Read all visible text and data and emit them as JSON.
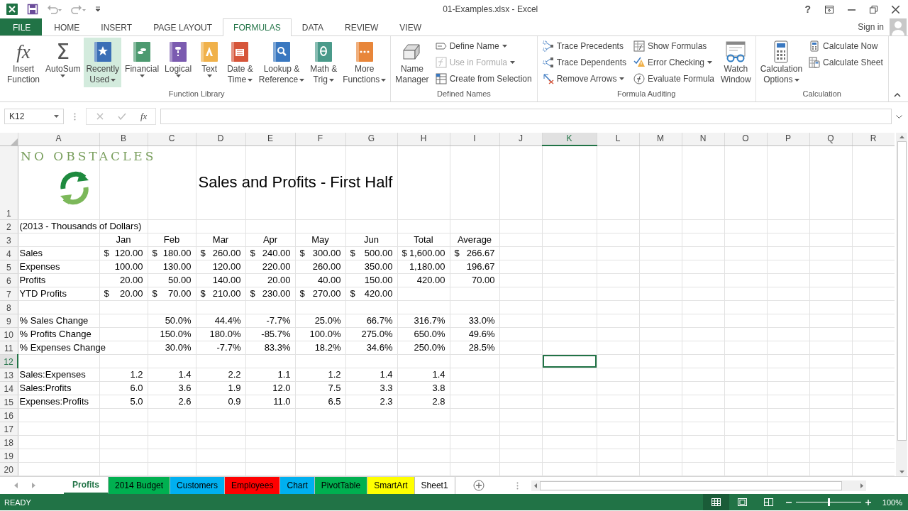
{
  "window": {
    "title": "01-Examples.xlsx - Excel",
    "help": "?",
    "sign_in": "Sign in"
  },
  "ribbon_tabs": [
    {
      "label": "FILE",
      "kind": "file",
      "selected": false
    },
    {
      "label": "HOME",
      "kind": "tab",
      "selected": false
    },
    {
      "label": "INSERT",
      "kind": "tab",
      "selected": false
    },
    {
      "label": "PAGE LAYOUT",
      "kind": "tab",
      "selected": false
    },
    {
      "label": "FORMULAS",
      "kind": "tab",
      "selected": true
    },
    {
      "label": "DATA",
      "kind": "tab",
      "selected": false
    },
    {
      "label": "REVIEW",
      "kind": "tab",
      "selected": false
    },
    {
      "label": "VIEW",
      "kind": "tab",
      "selected": false
    }
  ],
  "ribbon_groups": [
    {
      "label": "Function Library",
      "items": [
        {
          "kind": "large",
          "label": "Insert\nFunction",
          "glyph": "fx",
          "dropdown": false,
          "highlighted": false
        },
        {
          "kind": "large",
          "label": "AutoSum",
          "glyph": "Σ",
          "dropdown": true,
          "highlighted": false
        },
        {
          "kind": "large",
          "label": "Recently\nUsed",
          "dropdown": true,
          "highlighted": true
        },
        {
          "kind": "large",
          "label": "Financial",
          "dropdown": true,
          "highlighted": false
        },
        {
          "kind": "large",
          "label": "Logical",
          "dropdown": true,
          "highlighted": false
        },
        {
          "kind": "large",
          "label": "Text",
          "dropdown": true,
          "highlighted": false
        },
        {
          "kind": "large",
          "label": "Date &\nTime",
          "dropdown": true,
          "highlighted": false
        },
        {
          "kind": "large",
          "label": "Lookup &\nReference",
          "dropdown": true,
          "highlighted": false
        },
        {
          "kind": "large",
          "label": "Math &\nTrig",
          "dropdown": true,
          "highlighted": false
        },
        {
          "kind": "large",
          "label": "More\nFunctions",
          "dropdown": true,
          "highlighted": false
        }
      ]
    },
    {
      "label": "Defined Names",
      "items": [
        {
          "kind": "large",
          "label": "Name\nManager",
          "dropdown": false,
          "highlighted": false
        },
        {
          "kind": "column",
          "items": [
            {
              "label": "Define Name",
              "dropdown": true,
              "disabled": false
            },
            {
              "label": "Use in Formula",
              "dropdown": true,
              "disabled": true
            },
            {
              "label": "Create from Selection",
              "dropdown": false,
              "disabled": false
            }
          ]
        }
      ]
    },
    {
      "label": "Formula Auditing",
      "items": [
        {
          "kind": "column",
          "items": [
            {
              "label": "Trace Precedents",
              "dropdown": false,
              "disabled": false
            },
            {
              "label": "Trace Dependents",
              "dropdown": false,
              "disabled": false
            },
            {
              "label": "Remove Arrows",
              "dropdown": true,
              "disabled": false
            }
          ]
        },
        {
          "kind": "column",
          "items": [
            {
              "label": "Show Formulas",
              "dropdown": false,
              "disabled": false
            },
            {
              "label": "Error Checking",
              "dropdown": true,
              "disabled": false
            },
            {
              "label": "Evaluate Formula",
              "dropdown": false,
              "disabled": false
            }
          ]
        },
        {
          "kind": "large",
          "label": "Watch\nWindow",
          "dropdown": false,
          "highlighted": false
        }
      ]
    },
    {
      "label": "Calculation",
      "items": [
        {
          "kind": "large",
          "label": "Calculation\nOptions",
          "dropdown": true,
          "highlighted": false
        },
        {
          "kind": "column",
          "items": [
            {
              "label": "Calculate Now",
              "dropdown": false,
              "disabled": false
            },
            {
              "label": "Calculate Sheet",
              "dropdown": false,
              "disabled": false
            }
          ]
        }
      ]
    }
  ],
  "formula_bar": {
    "name_box": "K12",
    "fx": "fx"
  },
  "sheet": {
    "logo": {
      "text": "NO OBSTACLES"
    },
    "columns": [
      {
        "label": "A",
        "selected": false
      },
      {
        "label": "B",
        "selected": false
      },
      {
        "label": "C",
        "selected": false
      },
      {
        "label": "D",
        "selected": false
      },
      {
        "label": "E",
        "selected": false
      },
      {
        "label": "F",
        "selected": false
      },
      {
        "label": "G",
        "selected": false
      },
      {
        "label": "H",
        "selected": false
      },
      {
        "label": "I",
        "selected": false
      },
      {
        "label": "J",
        "selected": false
      },
      {
        "label": "K",
        "selected": true
      },
      {
        "label": "L",
        "selected": false
      },
      {
        "label": "M",
        "selected": false
      },
      {
        "label": "N",
        "selected": false
      },
      {
        "label": "O",
        "selected": false
      },
      {
        "label": "P",
        "selected": false
      },
      {
        "label": "Q",
        "selected": false
      },
      {
        "label": "R",
        "selected": false
      }
    ],
    "rows": [
      {
        "number": "1",
        "selected": false,
        "cells": [
          null,
          null,
          null,
          {
            "text": "Sales and Profits - First Half",
            "kind": "title"
          }
        ]
      },
      {
        "number": "2",
        "selected": false,
        "cells": [
          {
            "text": "(2013 - Thousands of Dollars)",
            "kind": "label"
          }
        ]
      },
      {
        "number": "3",
        "selected": false,
        "cells": [
          null,
          {
            "text": "Jan",
            "kind": "header"
          },
          {
            "text": "Feb",
            "kind": "header"
          },
          {
            "text": "Mar",
            "kind": "header"
          },
          {
            "text": "Apr",
            "kind": "header"
          },
          {
            "text": "May",
            "kind": "header"
          },
          {
            "text": "Jun",
            "kind": "header"
          },
          {
            "text": "Total",
            "kind": "header"
          },
          {
            "text": "Average",
            "kind": "header"
          }
        ]
      },
      {
        "number": "4",
        "selected": false,
        "cells": [
          {
            "text": "Sales",
            "kind": "label"
          },
          {
            "symbol": "$",
            "text": "120.00",
            "kind": "accounting"
          },
          {
            "symbol": "$",
            "text": "180.00",
            "kind": "accounting"
          },
          {
            "symbol": "$",
            "text": "260.00",
            "kind": "accounting"
          },
          {
            "symbol": "$",
            "text": "240.00",
            "kind": "accounting"
          },
          {
            "symbol": "$",
            "text": "300.00",
            "kind": "accounting"
          },
          {
            "symbol": "$",
            "text": "500.00",
            "kind": "accounting"
          },
          {
            "symbol": "$",
            "text": "1,600.00",
            "kind": "accounting"
          },
          {
            "symbol": "$",
            "text": "266.67",
            "kind": "accounting"
          }
        ]
      },
      {
        "number": "5",
        "selected": false,
        "cells": [
          {
            "text": "Expenses",
            "kind": "label"
          },
          {
            "text": "100.00",
            "kind": "number"
          },
          {
            "text": "130.00",
            "kind": "number"
          },
          {
            "text": "120.00",
            "kind": "number"
          },
          {
            "text": "220.00",
            "kind": "number"
          },
          {
            "text": "260.00",
            "kind": "number"
          },
          {
            "text": "350.00",
            "kind": "number"
          },
          {
            "text": "1,180.00",
            "kind": "number"
          },
          {
            "text": "196.67",
            "kind": "number"
          }
        ]
      },
      {
        "number": "6",
        "selected": false,
        "cells": [
          {
            "text": "Profits",
            "kind": "label"
          },
          {
            "text": "20.00",
            "kind": "number"
          },
          {
            "text": "50.00",
            "kind": "number"
          },
          {
            "text": "140.00",
            "kind": "number"
          },
          {
            "text": "20.00",
            "kind": "number"
          },
          {
            "text": "40.00",
            "kind": "number"
          },
          {
            "text": "150.00",
            "kind": "number"
          },
          {
            "text": "420.00",
            "kind": "number"
          },
          {
            "text": "70.00",
            "kind": "number"
          }
        ]
      },
      {
        "number": "7",
        "selected": false,
        "cells": [
          {
            "text": "YTD Profits",
            "kind": "label"
          },
          {
            "symbol": "$",
            "text": "20.00",
            "kind": "accounting"
          },
          {
            "symbol": "$",
            "text": "70.00",
            "kind": "accounting"
          },
          {
            "symbol": "$",
            "text": "210.00",
            "kind": "accounting"
          },
          {
            "symbol": "$",
            "text": "230.00",
            "kind": "accounting"
          },
          {
            "symbol": "$",
            "text": "270.00",
            "kind": "accounting"
          },
          {
            "symbol": "$",
            "text": "420.00",
            "kind": "accounting"
          }
        ]
      },
      {
        "number": "8",
        "selected": false,
        "cells": []
      },
      {
        "number": "9",
        "selected": false,
        "cells": [
          {
            "text": "% Sales Change",
            "kind": "label"
          },
          null,
          {
            "text": "50.0%",
            "kind": "number"
          },
          {
            "text": "44.4%",
            "kind": "number"
          },
          {
            "text": "-7.7%",
            "kind": "number"
          },
          {
            "text": "25.0%",
            "kind": "number"
          },
          {
            "text": "66.7%",
            "kind": "number"
          },
          {
            "text": "316.7%",
            "kind": "number"
          },
          {
            "text": "33.0%",
            "kind": "number"
          }
        ]
      },
      {
        "number": "10",
        "selected": false,
        "cells": [
          {
            "text": "% Profits Change",
            "kind": "label"
          },
          null,
          {
            "text": "150.0%",
            "kind": "number"
          },
          {
            "text": "180.0%",
            "kind": "number"
          },
          {
            "text": "-85.7%",
            "kind": "number"
          },
          {
            "text": "100.0%",
            "kind": "number"
          },
          {
            "text": "275.0%",
            "kind": "number"
          },
          {
            "text": "650.0%",
            "kind": "number"
          },
          {
            "text": "49.6%",
            "kind": "number"
          }
        ]
      },
      {
        "number": "11",
        "selected": false,
        "cells": [
          {
            "text": "% Expenses Change",
            "kind": "label"
          },
          null,
          {
            "text": "30.0%",
            "kind": "number"
          },
          {
            "text": "-7.7%",
            "kind": "number"
          },
          {
            "text": "83.3%",
            "kind": "number"
          },
          {
            "text": "18.2%",
            "kind": "number"
          },
          {
            "text": "34.6%",
            "kind": "number"
          },
          {
            "text": "250.0%",
            "kind": "number"
          },
          {
            "text": "28.5%",
            "kind": "number"
          }
        ]
      },
      {
        "number": "12",
        "selected": true,
        "cells": []
      },
      {
        "number": "13",
        "selected": false,
        "cells": [
          {
            "text": "Sales:Expenses",
            "kind": "label"
          },
          {
            "text": "1.2",
            "kind": "number"
          },
          {
            "text": "1.4",
            "kind": "number"
          },
          {
            "text": "2.2",
            "kind": "number"
          },
          {
            "text": "1.1",
            "kind": "number"
          },
          {
            "text": "1.2",
            "kind": "number"
          },
          {
            "text": "1.4",
            "kind": "number"
          },
          {
            "text": "1.4",
            "kind": "number"
          }
        ]
      },
      {
        "number": "14",
        "selected": false,
        "cells": [
          {
            "text": "Sales:Profits",
            "kind": "label"
          },
          {
            "text": "6.0",
            "kind": "number"
          },
          {
            "text": "3.6",
            "kind": "number"
          },
          {
            "text": "1.9",
            "kind": "number"
          },
          {
            "text": "12.0",
            "kind": "number"
          },
          {
            "text": "7.5",
            "kind": "number"
          },
          {
            "text": "3.3",
            "kind": "number"
          },
          {
            "text": "3.8",
            "kind": "number"
          }
        ]
      },
      {
        "number": "15",
        "selected": false,
        "cells": [
          {
            "text": "Expenses:Profits",
            "kind": "label"
          },
          {
            "text": "5.0",
            "kind": "number"
          },
          {
            "text": "2.6",
            "kind": "number"
          },
          {
            "text": "0.9",
            "kind": "number"
          },
          {
            "text": "11.0",
            "kind": "number"
          },
          {
            "text": "6.5",
            "kind": "number"
          },
          {
            "text": "2.3",
            "kind": "number"
          },
          {
            "text": "2.8",
            "kind": "number"
          }
        ]
      },
      {
        "number": "16",
        "selected": false,
        "cells": []
      },
      {
        "number": "17",
        "selected": false,
        "cells": []
      },
      {
        "number": "18",
        "selected": false,
        "cells": []
      },
      {
        "number": "19",
        "selected": false,
        "cells": []
      },
      {
        "number": "20",
        "selected": false,
        "cells": []
      }
    ]
  },
  "sheet_tabs": [
    {
      "label": "Profits",
      "selected": true
    },
    {
      "label": "2014 Budget",
      "selected": false,
      "color": "#00b050"
    },
    {
      "label": "Customers",
      "selected": false,
      "color": "#00b0f0"
    },
    {
      "label": "Employees",
      "selected": false,
      "color": "#ff0000"
    },
    {
      "label": "Chart",
      "selected": false,
      "color": "#00b0f0"
    },
    {
      "label": "PivotTable",
      "selected": false,
      "color": "#00b050"
    },
    {
      "label": "SmartArt",
      "selected": false,
      "color": "#ffff00"
    },
    {
      "label": "Sheet1",
      "selected": false
    }
  ],
  "status_bar": {
    "mode": "READY",
    "zoom": {
      "level": 0.5,
      "reading": "100%"
    }
  }
}
